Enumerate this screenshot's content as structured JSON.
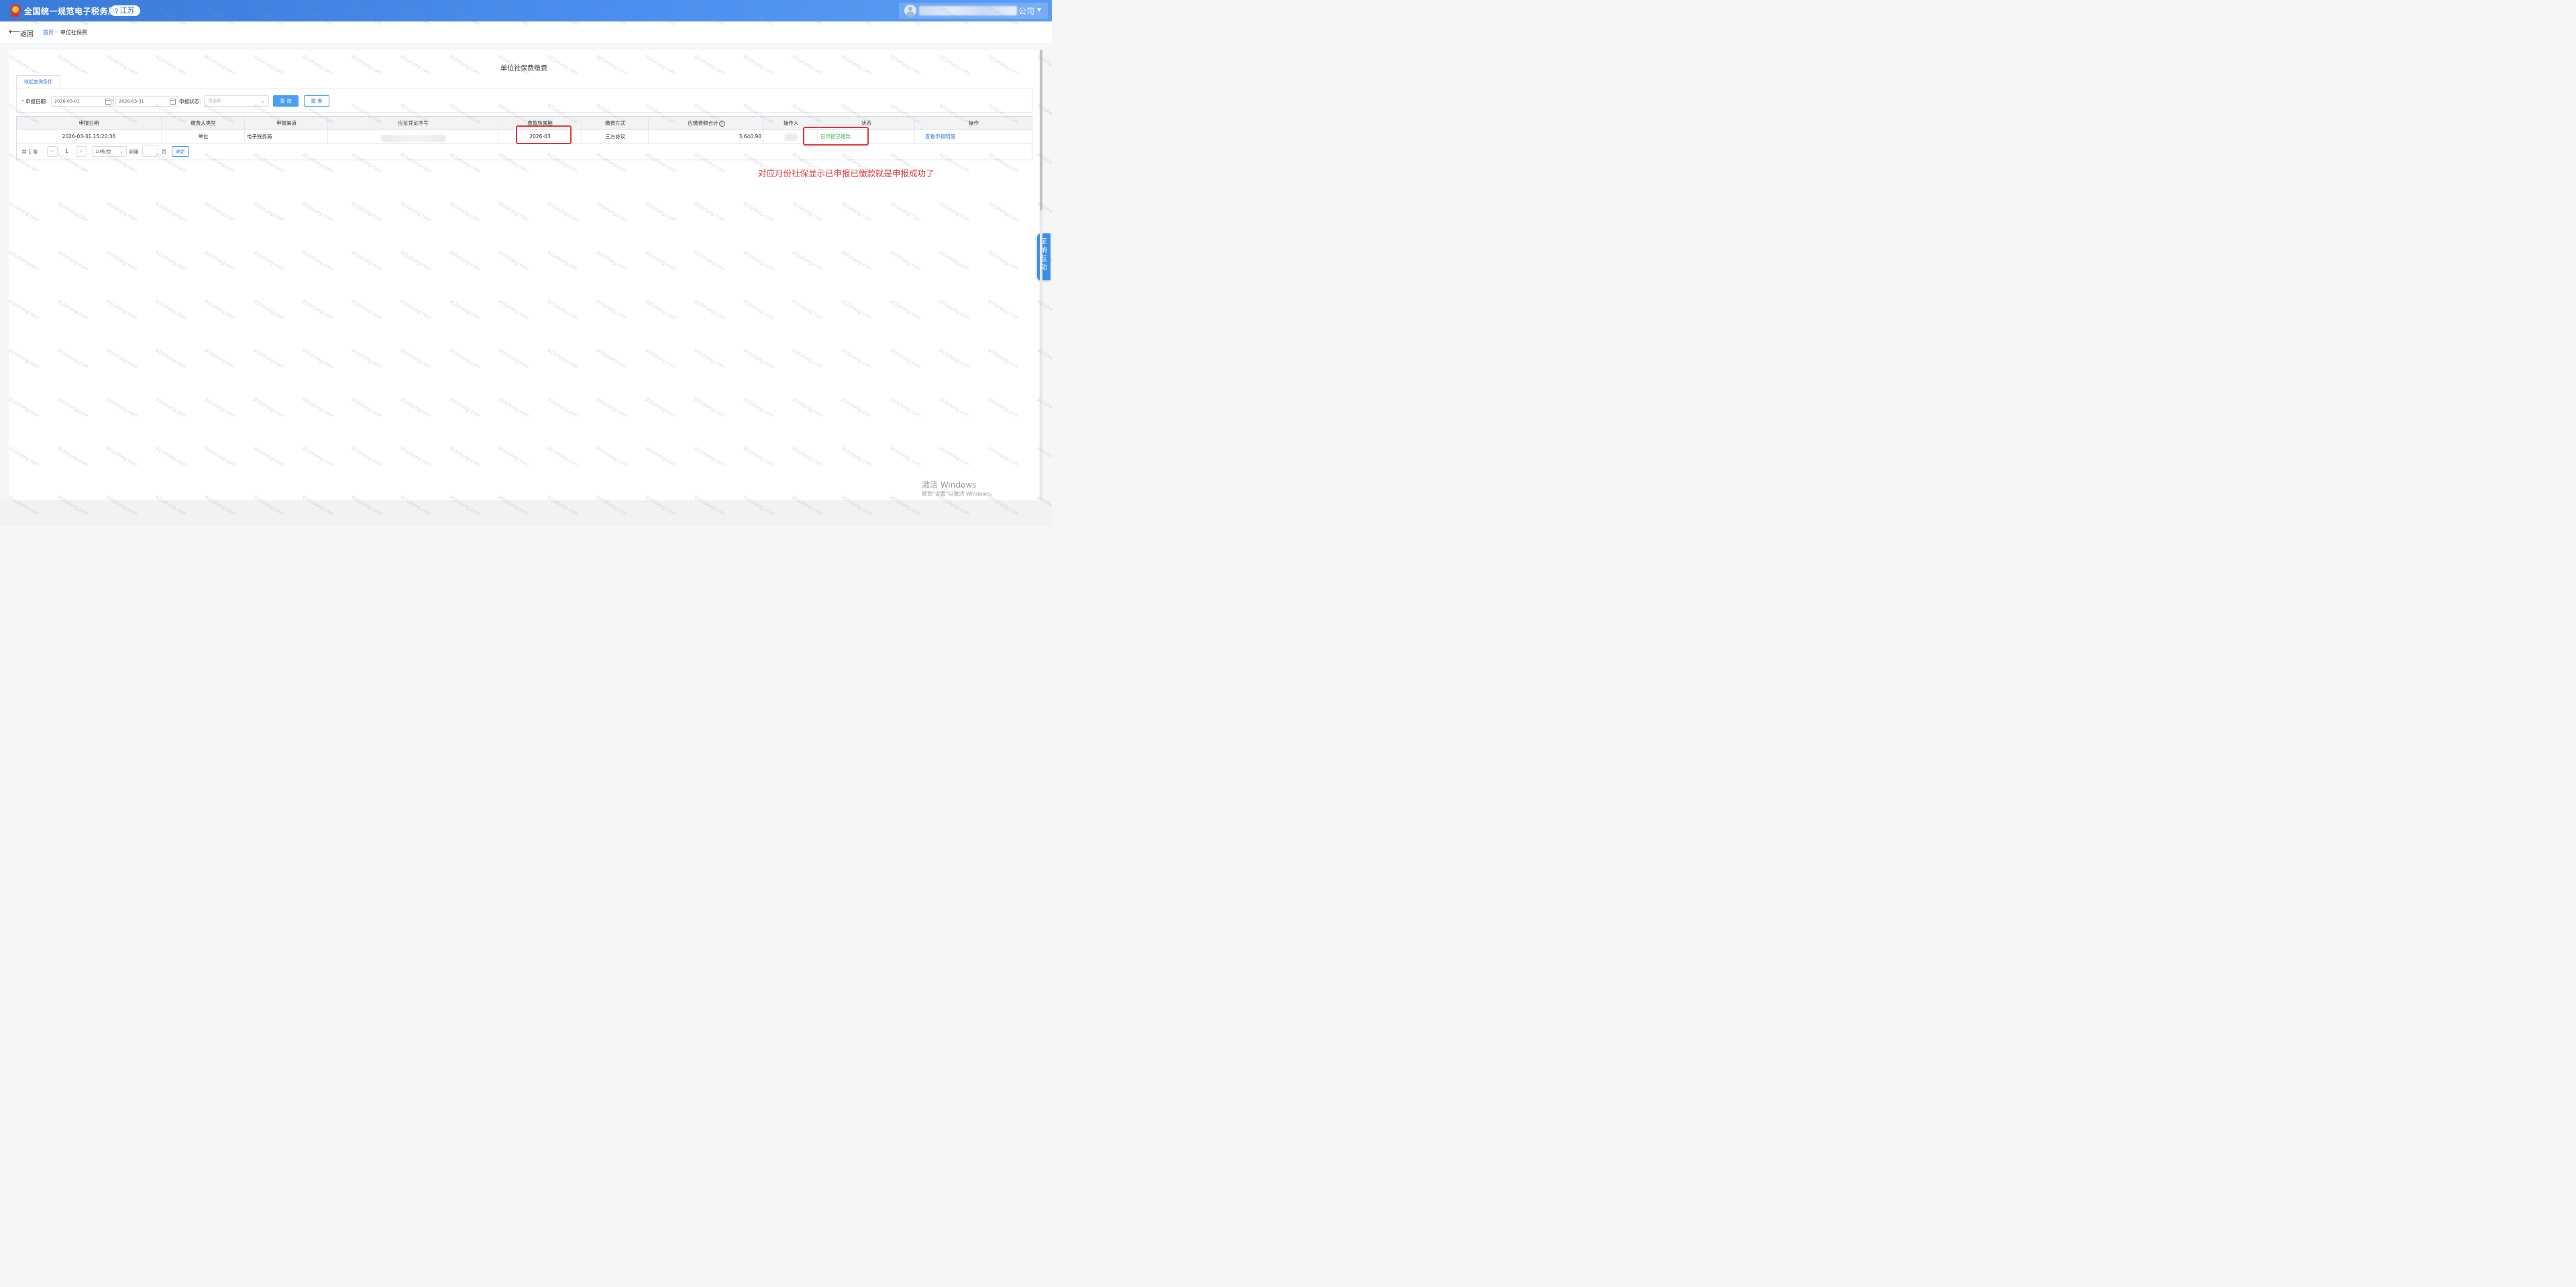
{
  "header": {
    "app_title": "全国统一规范电子税务局",
    "region": "江苏",
    "company_suffix": "公司"
  },
  "breadcrumb": {
    "back_label": "返回",
    "home": "首页",
    "current": "单位社保费"
  },
  "page": {
    "title": "单位社保费缴费",
    "tab_label": "收起查询条件"
  },
  "filters": {
    "date_label": "申报日期:",
    "date_from": "2026-03-01",
    "date_to": "2026-03-31",
    "date_separator": "-",
    "status_label": "申报状态:",
    "status_placeholder": "请选择",
    "query_button": "查 询",
    "reset_button": "重 置"
  },
  "table": {
    "columns": [
      "申报日期",
      "缴费人类型",
      "申报渠道",
      "应征凭证序号",
      "费款所属期",
      "缴费方式",
      "应缴费额合计",
      "操作人",
      "状态",
      "操作"
    ],
    "rows": [
      {
        "date": "2026-03-31 15:20:36",
        "payer_type": "单位",
        "channel": "电子税务局",
        "voucher_no": "",
        "period": "2026-03",
        "pay_method": "三方协议",
        "amount": "3,640.90",
        "operator": "",
        "status": "已申报已缴款",
        "action": "查看申报明细"
      }
    ]
  },
  "pagination": {
    "total_prefix": "共",
    "total_count": "1",
    "total_suffix": "条",
    "prev": "<",
    "current_page": "1",
    "next": ">",
    "page_size": "10条/页",
    "goto_label": "到第",
    "page_suffix": "页",
    "confirm": "确定"
  },
  "annotation": {
    "text": "对应月份社保显示已申报已缴款就是申报成功了",
    "color": "#e03a3a"
  },
  "side_widget": {
    "chars": [
      "征",
      "纳",
      "互",
      "动"
    ]
  },
  "windows_activation": {
    "title": "激活 Windows",
    "subtitle": "转到\"设置\"以激活 Windows。"
  },
  "watermark_text": "91lizhang.com",
  "colors": {
    "header_blue": "#3a7ad8",
    "accent": "#4a9ff5",
    "status_green": "#52b35a",
    "annotation_red": "#e03a3a"
  }
}
